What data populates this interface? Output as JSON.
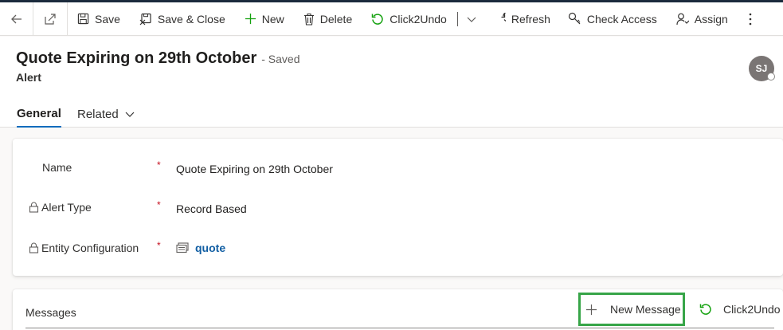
{
  "toolbar": {
    "save": "Save",
    "save_close": "Save & Close",
    "new": "New",
    "delete": "Delete",
    "click2undo": "Click2Undo",
    "refresh": "Refresh",
    "check_access": "Check Access",
    "assign": "Assign"
  },
  "header": {
    "title": "Quote Expiring on 29th October",
    "save_status": "- Saved",
    "entity_name": "Alert",
    "avatar_initials": "SJ"
  },
  "tabs": {
    "general": "General",
    "related": "Related"
  },
  "form": {
    "required_mark": "*",
    "name_label": "Name",
    "name_value": "Quote Expiring on 29th October",
    "alert_type_label": "Alert Type",
    "alert_type_value": "Record Based",
    "entity_config_label": "Entity Configuration",
    "entity_config_value": "quote"
  },
  "messages": {
    "title": "Messages",
    "new_message": "New Message",
    "click2undo": "Click2Undo"
  },
  "colors": {
    "accent": "#0f6cbd",
    "link": "#115ea3",
    "required": "#c50f1f",
    "undo_green": "#13a10e",
    "highlight_box": "#37a548"
  }
}
